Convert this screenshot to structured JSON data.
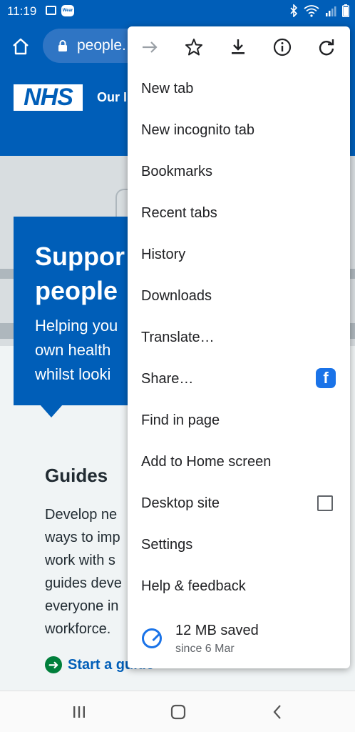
{
  "status_bar": {
    "time": "11:19",
    "notification_icon": "image-icon",
    "app_icon_text": "Wear"
  },
  "address_bar": {
    "url": "people."
  },
  "page": {
    "org_logo": "NHS",
    "org_name": "Our I",
    "hero_title": "Suppor\npeople",
    "hero_desc": "Helping you\nown health\nwhilst looki",
    "guides_title": "Guides",
    "guides_text": "Develop ne\nways to imp\nwork with s\nguides deve\neveryone in\nworkforce.",
    "start_link": "Start a guide"
  },
  "menu": {
    "toolbar": [
      "forward-icon",
      "star-icon",
      "download-icon",
      "info-icon",
      "refresh-icon"
    ],
    "items": [
      {
        "label": "New tab"
      },
      {
        "label": "New incognito tab"
      },
      {
        "label": "Bookmarks"
      },
      {
        "label": "Recent tabs"
      },
      {
        "label": "History"
      },
      {
        "label": "Downloads"
      },
      {
        "label": "Translate…"
      },
      {
        "label": "Share…"
      },
      {
        "label": "Find in page"
      },
      {
        "label": "Add to Home screen"
      },
      {
        "label": "Desktop site"
      },
      {
        "label": "Settings"
      },
      {
        "label": "Help & feedback"
      }
    ],
    "share_badge": "f",
    "desktop_site_checked": false,
    "data_saved": {
      "amount": "12 MB saved",
      "since": "since 6 Mar"
    }
  },
  "colors": {
    "nhs_blue": "#005eb8",
    "accent": "#1a73e8",
    "nhs_green": "#007f3b"
  }
}
